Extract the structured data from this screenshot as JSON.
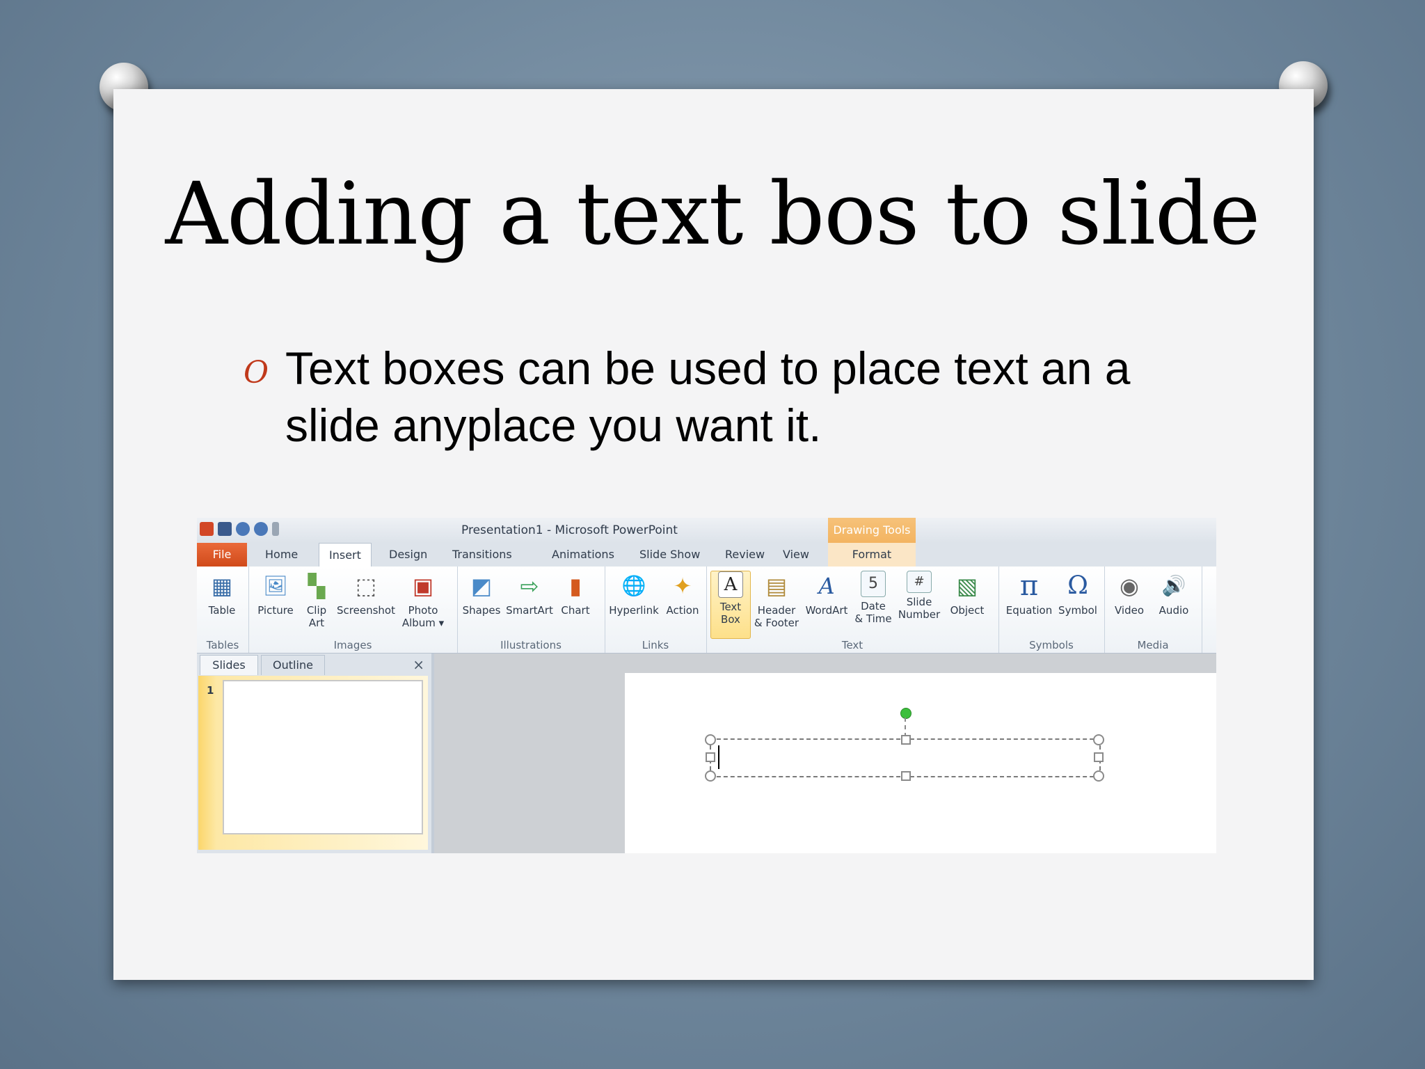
{
  "slide": {
    "title": "Adding a text bos to slide",
    "bullet_glyph": "O",
    "bullet_line1": "Text boxes can be used to place text an a",
    "bullet_line2": "slide anyplace you want it."
  },
  "powerpoint": {
    "window_title": "Presentation1  -  Microsoft PowerPoint",
    "contextual_tab_header": "Drawing Tools",
    "tabs": {
      "file": "File",
      "home": "Home",
      "insert": "Insert",
      "design": "Design",
      "transitions": "Transitions",
      "animations": "Animations",
      "slide_show": "Slide Show",
      "review": "Review",
      "view": "View",
      "format": "Format"
    },
    "ribbon": {
      "table": "Table",
      "picture": "Picture",
      "clip_art_1": "Clip",
      "clip_art_2": "Art",
      "screenshot": "Screenshot",
      "photo_album_1": "Photo",
      "photo_album_2": "Album ▾",
      "shapes": "Shapes",
      "smartart": "SmartArt",
      "chart": "Chart",
      "hyperlink": "Hyperlink",
      "action": "Action",
      "text_box_1": "Text",
      "text_box_2": "Box",
      "header_footer_1": "Header",
      "header_footer_2": "& Footer",
      "wordart": "WordArt",
      "date_time_1": "Date",
      "date_time_2": "& Time",
      "slide_number_1": "Slide",
      "slide_number_2": "Number",
      "object": "Object",
      "equation": "Equation",
      "symbol": "Symbol",
      "video": "Video",
      "audio": "Audio"
    },
    "groups": {
      "tables": "Tables",
      "images": "Images",
      "illustrations": "Illustrations",
      "links": "Links",
      "text": "Text",
      "symbols": "Symbols",
      "media": "Media"
    },
    "pane": {
      "slides_tab": "Slides",
      "outline_tab": "Outline",
      "close": "×",
      "thumb_number": "1"
    },
    "icons": {
      "table": "▦",
      "picture": "🖼",
      "clip_art": "▚",
      "screenshot": "⬚",
      "photo_album": "▣",
      "shapes": "◩",
      "smartart": "⇨",
      "chart": "▮",
      "hyperlink": "🌐",
      "action": "✦",
      "text_box": "A",
      "header_footer": "▤",
      "wordart": "A",
      "date_time": "5",
      "slide_number": "#",
      "object": "▧",
      "equation": "π",
      "symbol": "Ω",
      "video": "◉",
      "audio": "🔊"
    }
  }
}
